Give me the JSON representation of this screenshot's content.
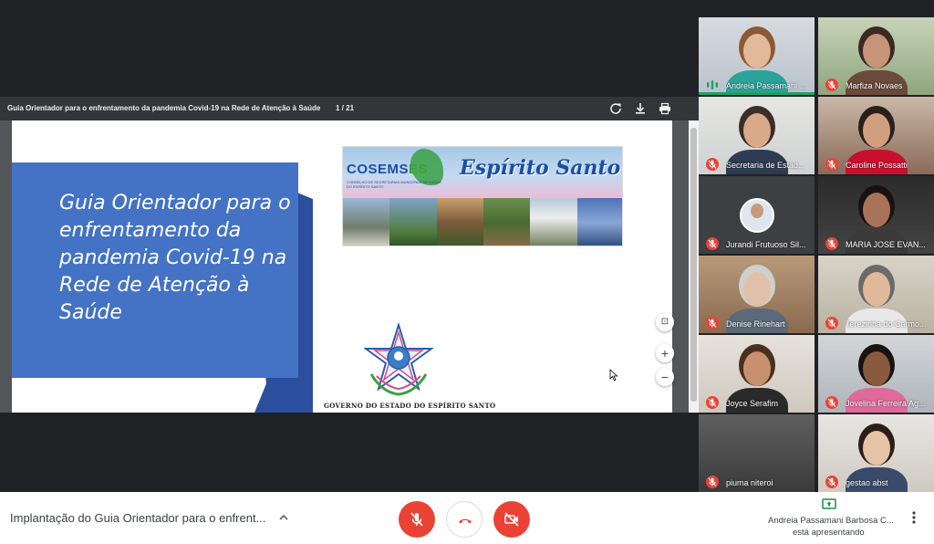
{
  "pdf": {
    "title": "Guia Orientador para o enfrentamento da pandemia Covid-19 na Rede de Atenção à Saúde",
    "pages": "1 / 21",
    "icons": [
      "rotate-icon",
      "download-icon",
      "print-icon"
    ]
  },
  "slide": {
    "title": "Guia Orientador para o enfrentamento da pandemia Covid-19 na Rede de Atenção à Saúde",
    "banner_cosems_a": "COSEMS",
    "banner_cosems_b": "ES",
    "banner_subtitle": "CONSELHO DE SECRETARIAS MUNICIPAIS DE SAÚDE DO ESPÍRITO SANTO",
    "banner_state": "Espírito Santo",
    "government": "GOVERNO DO ESTADO DO ESPÍRITO SANTO"
  },
  "zoom": {
    "fit": "⊡",
    "in": "+",
    "out": "−"
  },
  "participants": [
    {
      "name": "Andreia Passamani ...",
      "muted": false,
      "speaking": true
    },
    {
      "name": "Marfiza Novaes",
      "muted": true
    },
    {
      "name": "Secretaria de Estad...",
      "muted": true
    },
    {
      "name": "Caroline Possatti",
      "muted": true
    },
    {
      "name": "Jurandi Frutuoso Sil...",
      "muted": true
    },
    {
      "name": "MARIA JOSE EVAN...",
      "muted": true
    },
    {
      "name": "Denise Rinehart",
      "muted": true
    },
    {
      "name": "Terezinha do Carmo...",
      "muted": true
    },
    {
      "name": "Joyce Serafim",
      "muted": true
    },
    {
      "name": "Jovelina Ferreira Ag...",
      "muted": true
    },
    {
      "name": "piuma niteroi",
      "muted": true
    },
    {
      "name": "gestao abst",
      "muted": true
    }
  ],
  "bottom": {
    "meeting_title": "Implantação do Guia Orientador para o enfrent...",
    "presenter_name": "Andreia Passamani Barbosa C...",
    "presenter_status": "está apresentando"
  },
  "colors": {
    "danger": "#ea4335",
    "slide_blue": "#4472c4",
    "speaking": "#1ea362"
  }
}
